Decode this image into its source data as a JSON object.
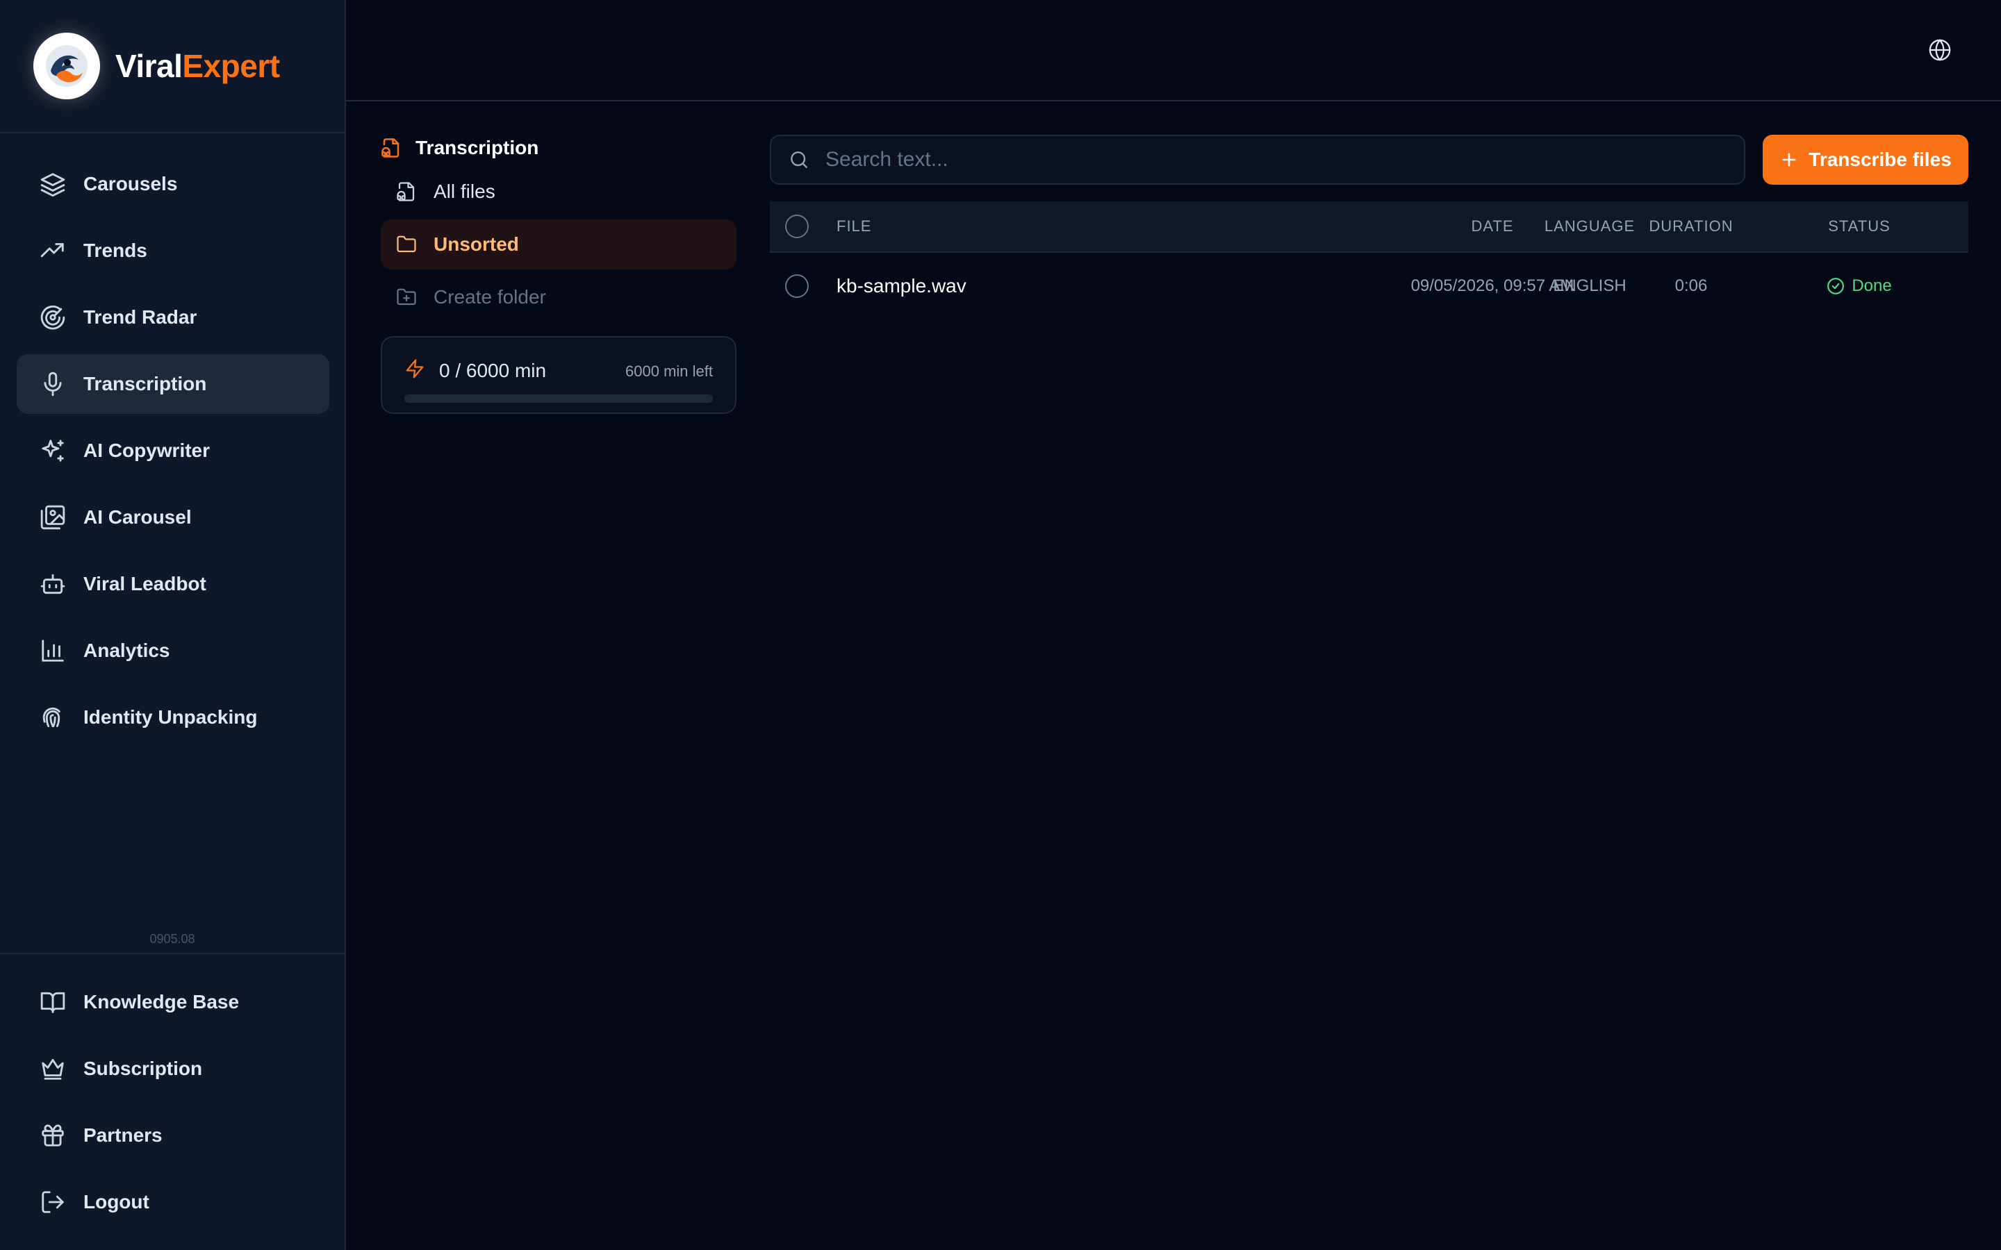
{
  "brand": {
    "name_part1": "Viral",
    "name_part2": "Expert"
  },
  "sidebar": {
    "items": [
      {
        "label": "Carousels",
        "icon": "layers-icon"
      },
      {
        "label": "Trends",
        "icon": "trending-up-icon"
      },
      {
        "label": "Trend Radar",
        "icon": "radar-icon"
      },
      {
        "label": "Transcription",
        "icon": "microphone-icon",
        "active": true
      },
      {
        "label": "AI Copywriter",
        "icon": "sparkles-icon"
      },
      {
        "label": "AI Carousel",
        "icon": "images-icon"
      },
      {
        "label": "Viral Leadbot",
        "icon": "bot-icon"
      },
      {
        "label": "Analytics",
        "icon": "bar-chart-icon"
      },
      {
        "label": "Identity Unpacking",
        "icon": "fingerprint-icon"
      }
    ],
    "version": "0905.08",
    "bottom_items": [
      {
        "label": "Knowledge Base",
        "icon": "book-icon"
      },
      {
        "label": "Subscription",
        "icon": "crown-icon"
      },
      {
        "label": "Partners",
        "icon": "gift-icon"
      },
      {
        "label": "Logout",
        "icon": "logout-icon"
      }
    ]
  },
  "topbar": {
    "language_icon": "globe-icon"
  },
  "folders": {
    "title": "Transcription",
    "items": [
      {
        "label": "All files",
        "icon": "audio-file-icon"
      },
      {
        "label": "Unsorted",
        "icon": "folder-icon",
        "active": true
      },
      {
        "label": "Create folder",
        "icon": "folder-plus-icon"
      }
    ],
    "quota": {
      "used": "0 / 6000 min",
      "left": "6000 min left",
      "fraction_used": 0
    }
  },
  "search": {
    "placeholder": "Search text...",
    "value": ""
  },
  "actions": {
    "transcribe_label": "Transcribe files"
  },
  "table": {
    "columns": {
      "file": "FILE",
      "date": "DATE",
      "language": "LANGUAGE",
      "duration": "DURATION",
      "status": "STATUS"
    },
    "rows": [
      {
        "file": "kb-sample.wav",
        "date": "09/05/2026, 09:57 AM",
        "language": "ENGLISH",
        "duration": "0:06",
        "status": "Done"
      }
    ]
  },
  "colors": {
    "accent": "#f97316",
    "success": "#4ade80",
    "background": "#050816",
    "sidebar": "#0f172a"
  }
}
